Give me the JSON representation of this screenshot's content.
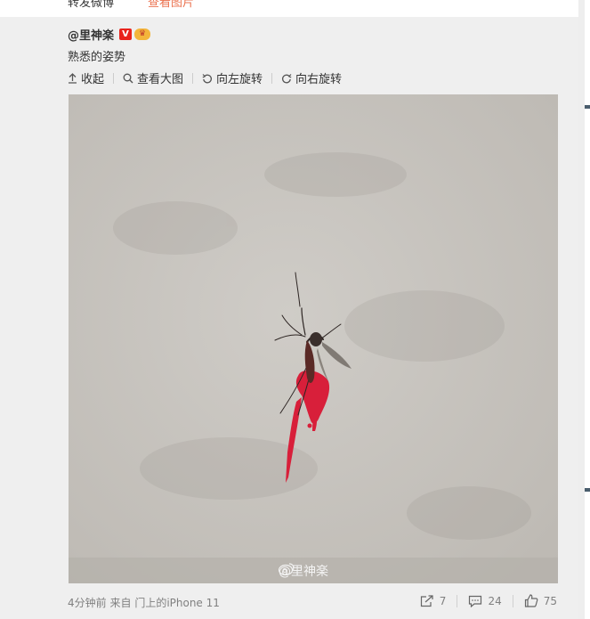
{
  "previous_post": {
    "repost_text": "转发微博",
    "view_image_label": "查看图片"
  },
  "post": {
    "author": "@里神楽",
    "verified_badge": "V",
    "text": "熟悉的姿势",
    "toolbar": {
      "collapse": "收起",
      "view_large": "查看大图",
      "rotate_left": "向左旋转",
      "rotate_right": "向右旋转"
    },
    "image": {
      "watermark": "@里神楽"
    },
    "footer": {
      "time": "4分钟前",
      "from_label": "来自",
      "source": "门上的iPhone 11",
      "reposts": "7",
      "comments": "24",
      "likes": "75"
    }
  },
  "colors": {
    "link": "#eb7350",
    "background": "#efefef",
    "wall": "#c9c6c1",
    "blood": "#d81f3a"
  }
}
